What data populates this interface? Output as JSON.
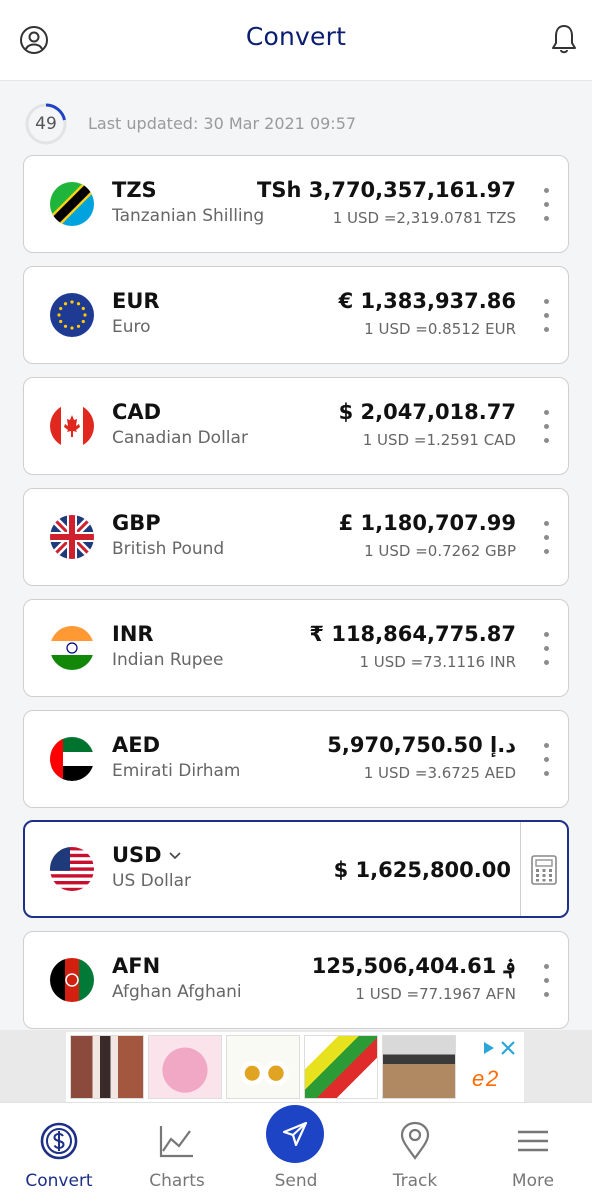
{
  "header": {
    "title": "Convert"
  },
  "status": {
    "refresh_count": "49",
    "last_updated": "Last updated: 30 Mar 2021 09:57"
  },
  "currencies": [
    {
      "code": "TZS",
      "name": "Tanzanian Shilling",
      "amount": "TSh 3,770,357,161.97",
      "rate": "1 USD =2,319.0781 TZS"
    },
    {
      "code": "EUR",
      "name": "Euro",
      "amount": "€ 1,383,937.86",
      "rate": "1 USD =0.8512 EUR"
    },
    {
      "code": "CAD",
      "name": "Canadian Dollar",
      "amount": "$ 2,047,018.77",
      "rate": "1 USD =1.2591 CAD"
    },
    {
      "code": "GBP",
      "name": "British Pound",
      "amount": "£ 1,180,707.99",
      "rate": "1 USD =0.7262 GBP"
    },
    {
      "code": "INR",
      "name": "Indian Rupee",
      "amount": "₹ 118,864,775.87",
      "rate": "1 USD =73.1116 INR"
    },
    {
      "code": "AED",
      "name": "Emirati Dirham",
      "amount": "5,970,750.50 د.إ",
      "rate": "1 USD =3.6725 AED"
    },
    {
      "code": "USD",
      "name": "US Dollar",
      "amount": "$ 1,625,800.00",
      "rate": ""
    },
    {
      "code": "AFN",
      "name": "Afghan Afghani",
      "amount": "125,506,404.61 ؋",
      "rate": "1 USD =77.1967 AFN"
    }
  ],
  "nav": {
    "convert": "Convert",
    "charts": "Charts",
    "send": "Send",
    "track": "Track",
    "more": "More"
  },
  "colors": {
    "primary": "#1d2f87",
    "send_button": "#1d44c4",
    "title": "#0b1d70"
  }
}
